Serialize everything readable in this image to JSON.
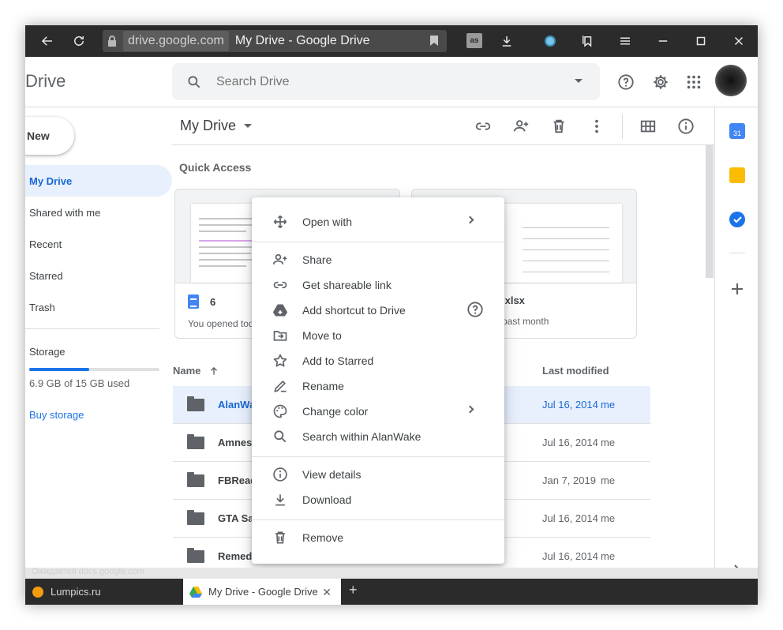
{
  "browser": {
    "host": "drive.google.com",
    "page_title": "My Drive - Google Drive",
    "lastfm_label": "as"
  },
  "drive": {
    "brand": "Drive",
    "search_placeholder": "Search Drive",
    "new_label": "New",
    "nav": [
      {
        "label": "My Drive",
        "active": true
      },
      {
        "label": "Shared with me"
      },
      {
        "label": "Recent"
      },
      {
        "label": "Starred"
      },
      {
        "label": "Trash"
      }
    ],
    "storage_label": "Storage",
    "storage_fraction": 0.46,
    "storage_used": "6.9 GB of 15 GB used",
    "buy_storage": "Buy storage",
    "main_title": "My Drive",
    "quick_access": "Quick Access",
    "cards": [
      {
        "name": "6",
        "sub": "You opened tod"
      },
      {
        "name": ".xlsx",
        "sub": "past month"
      }
    ],
    "list_header": {
      "name": "Name",
      "last_modified": "Last modified"
    },
    "rows": [
      {
        "name": "AlanWa",
        "date": "Jul 16, 2014",
        "owner": "me",
        "selected": true
      },
      {
        "name": "Amnesi",
        "date": "Jul 16, 2014",
        "owner": "me"
      },
      {
        "name": "FBRead",
        "date": "Jan 7, 2019",
        "owner": "me"
      },
      {
        "name": "GTA Sa",
        "date": "Jul 16, 2014",
        "owner": "me"
      },
      {
        "name": "Remedy",
        "date": "Jul 16, 2014",
        "owner": "me"
      }
    ]
  },
  "context_menu": {
    "items": [
      {
        "label": "Open with",
        "icon": "open-with-icon",
        "submenu": true
      },
      {
        "label": "Share",
        "icon": "share-person-icon"
      },
      {
        "label": "Get shareable link",
        "icon": "link-icon"
      },
      {
        "label": "Add shortcut to Drive",
        "icon": "drive-shortcut-icon",
        "help": true
      },
      {
        "label": "Move to",
        "icon": "move-to-icon"
      },
      {
        "label": "Add to Starred",
        "icon": "star-icon"
      },
      {
        "label": "Rename",
        "icon": "rename-icon"
      },
      {
        "label": "Change color",
        "icon": "palette-icon",
        "submenu": true
      },
      {
        "label": "Search within AlanWake",
        "icon": "search-icon"
      },
      {
        "label": "View details",
        "icon": "info-icon"
      },
      {
        "label": "Download",
        "icon": "download-icon"
      },
      {
        "label": "Remove",
        "icon": "trash-icon"
      }
    ]
  },
  "status_text": "Ожидается docs.google.com",
  "tabs": [
    {
      "label": "Lumpics.ru",
      "active": false
    },
    {
      "label": "My Drive - Google Drive",
      "active": true
    }
  ],
  "colors": {
    "accent": "#1a73e8",
    "selected_bg": "#e8f0fe",
    "browser_chrome": "#2b2b2b"
  }
}
